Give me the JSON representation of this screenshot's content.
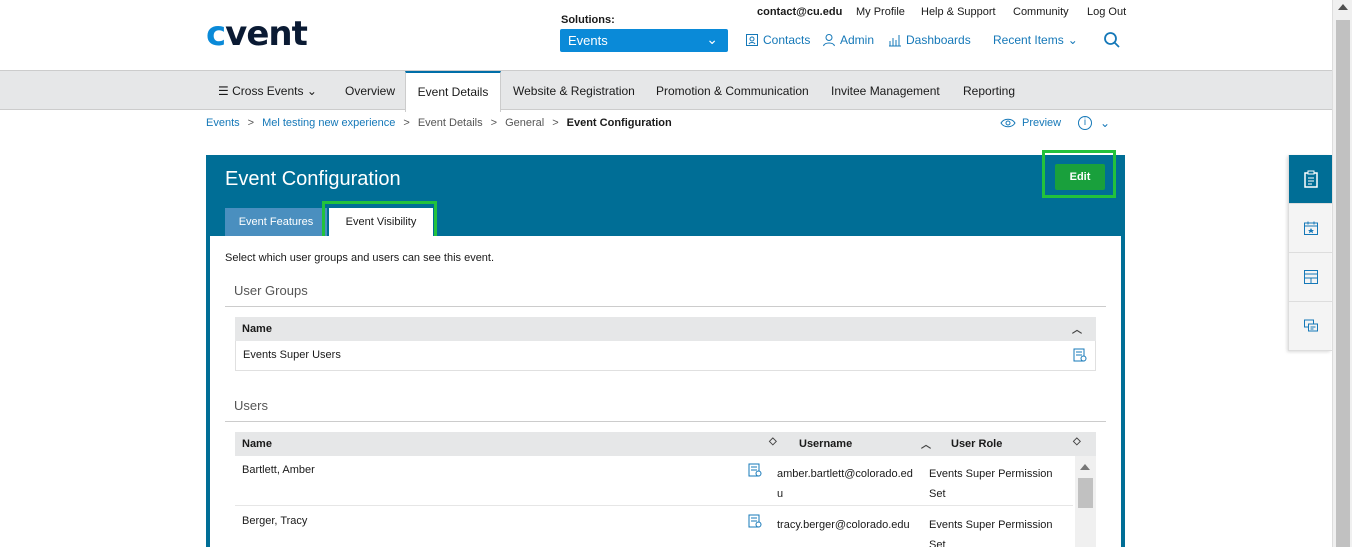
{
  "header": {
    "logo": {
      "c": "c",
      "rest": "vent"
    },
    "util": {
      "email": "contact@cu.edu",
      "profile": "My Profile",
      "help": "Help & Support",
      "community": "Community",
      "logout": "Log Out"
    },
    "solutions_label": "Solutions:",
    "solutions_value": "Events",
    "links": {
      "contacts": "Contacts",
      "admin": "Admin",
      "dashboards": "Dashboards",
      "recent": "Recent Items"
    }
  },
  "nav": {
    "cross_events": "Cross Events",
    "overview": "Overview",
    "event_details": "Event Details",
    "website": "Website & Registration",
    "promotion": "Promotion & Communication",
    "invitee": "Invitee Management",
    "reporting": "Reporting"
  },
  "breadcrumb": {
    "items": [
      "Events",
      "Mel testing new experience",
      "Event Details",
      "General"
    ],
    "current": "Event Configuration",
    "sep": ">",
    "preview": "Preview"
  },
  "panel": {
    "title": "Event Configuration",
    "edit_label": "Edit",
    "tabs": {
      "features": "Event Features",
      "visibility": "Event Visibility"
    },
    "intro": "Select which user groups and users can see this event.",
    "groups_heading": "User Groups",
    "groups_col_name": "Name",
    "groups_rows": [
      "Events Super Users"
    ],
    "users_heading": "Users",
    "users_cols": {
      "name": "Name",
      "username": "Username",
      "role": "User Role"
    },
    "users_rows": [
      {
        "name": "Bartlett, Amber",
        "username": "amber.bartlett@colorado.edu",
        "role": "Events Super Permission Set"
      },
      {
        "name": "Berger, Tracy",
        "username": "tracy.berger@colorado.edu",
        "role": "Events Super Permission Set"
      }
    ]
  },
  "colors": {
    "brand_blue": "#006e96",
    "link_blue": "#1578b8",
    "edit_green": "#19a03c",
    "highlight": "#22c23c"
  }
}
